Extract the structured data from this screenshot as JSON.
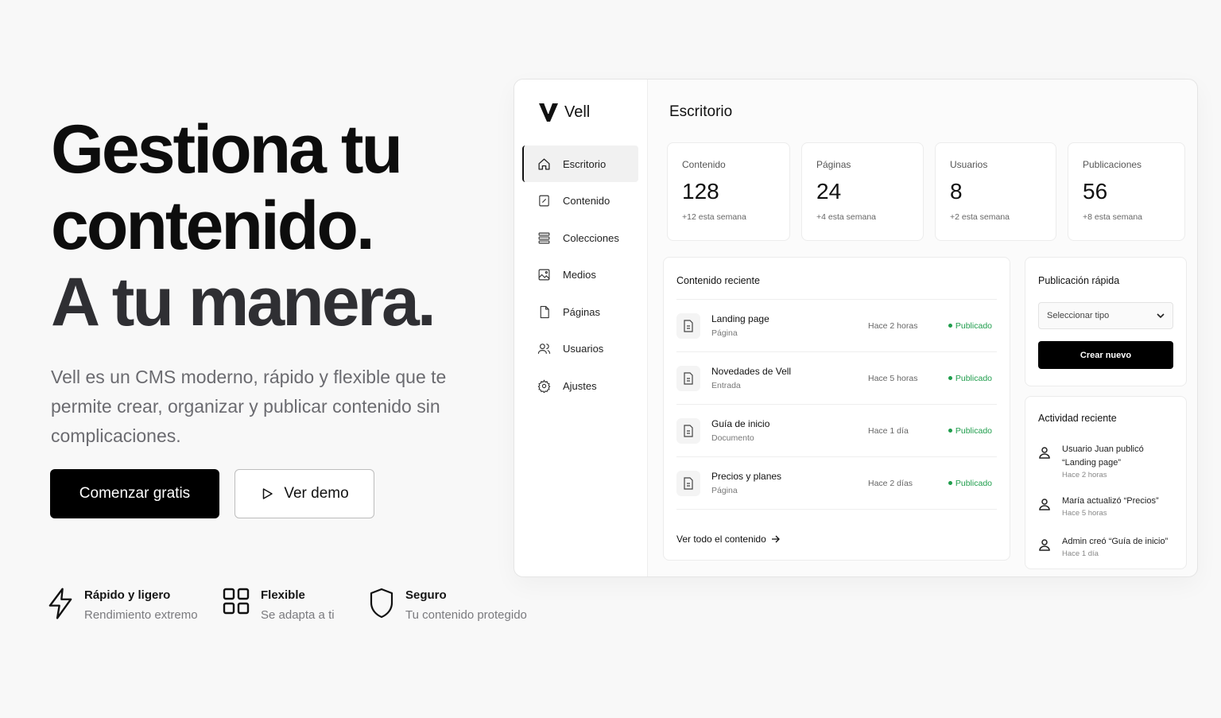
{
  "hero": {
    "line1": "Gestiona tu",
    "line2": "contenido.",
    "line3": "A tu manera.",
    "lede": "Vell es un CMS moderno, rápido y flexible que te permite crear, organizar y publicar contenido sin complicaciones.",
    "primary_cta": "Comenzar gratis",
    "secondary_cta": "Ver demo"
  },
  "features": [
    {
      "icon": "lightning-icon",
      "title": "Rápido y ligero",
      "subtitle": "Rendimiento extremo"
    },
    {
      "icon": "grid-icon",
      "title": "Flexible",
      "subtitle": "Se adapta a ti"
    },
    {
      "icon": "shield-icon",
      "title": "Seguro",
      "subtitle": "Tu contenido protegido"
    }
  ],
  "app": {
    "brand": "Vell",
    "nav": [
      {
        "label": "Escritorio",
        "icon": "home-icon",
        "active": true
      },
      {
        "label": "Contenido",
        "icon": "edit-doc-icon"
      },
      {
        "label": "Colecciones",
        "icon": "collections-icon"
      },
      {
        "label": "Medios",
        "icon": "image-icon"
      },
      {
        "label": "Páginas",
        "icon": "page-icon"
      },
      {
        "label": "Usuarios",
        "icon": "users-icon"
      },
      {
        "label": "Ajustes",
        "icon": "gear-icon"
      }
    ],
    "title": "Escritorio",
    "stats": [
      {
        "label": "Contenido",
        "value": "128",
        "delta": "+12 esta semana"
      },
      {
        "label": "Páginas",
        "value": "24",
        "delta": "+4 esta semana"
      },
      {
        "label": "Usuarios",
        "value": "8",
        "delta": "+2 esta semana"
      },
      {
        "label": "Publicaciones",
        "value": "56",
        "delta": "+8 esta semana"
      }
    ],
    "recent": {
      "title": "Contenido reciente",
      "items": [
        {
          "name": "Landing page",
          "type": "Página",
          "time": "Hace 2 horas",
          "status": "Publicado"
        },
        {
          "name": "Novedades de Vell",
          "type": "Entrada",
          "time": "Hace 5 horas",
          "status": "Publicado"
        },
        {
          "name": "Guía de inicio",
          "type": "Documento",
          "time": "Hace 1 día",
          "status": "Publicado"
        },
        {
          "name": "Precios y planes",
          "type": "Página",
          "time": "Hace 2 días",
          "status": "Publicado"
        }
      ],
      "see_all": "Ver todo el contenido"
    },
    "quick": {
      "title": "Publicación rápida",
      "select_placeholder": "Seleccionar tipo",
      "create": "Crear nuevo"
    },
    "activity": {
      "title": "Actividad reciente",
      "items": [
        {
          "text": "Usuario Juan publicó “Landing page”",
          "time": "Hace 2 horas"
        },
        {
          "text": "María actualizó “Precios”",
          "time": "Hace 5 horas"
        },
        {
          "text": "Admin creó “Guía de inicio”",
          "time": "Hace 1 día"
        }
      ]
    },
    "colors": {
      "accent": "#000000",
      "success": "#1f9d4c"
    }
  }
}
